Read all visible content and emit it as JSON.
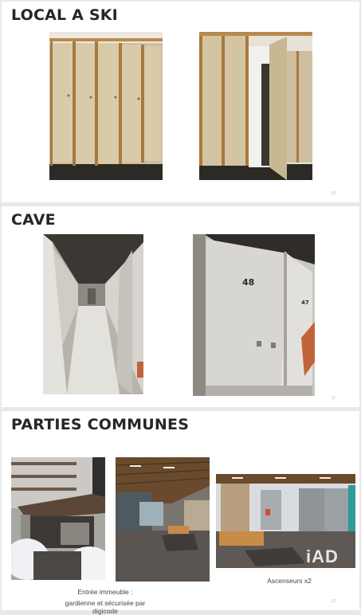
{
  "slides": [
    {
      "title": "LOCAL A SKI",
      "page": "10"
    },
    {
      "title": "CAVE",
      "page": "11"
    },
    {
      "title": "PARTIES COMMUNES",
      "page": "12"
    }
  ],
  "cave": {
    "door_number_left": "48",
    "door_number_right": "47"
  },
  "parties": {
    "caption_entrance_line1": "Entrée immeuble :",
    "caption_entrance_line2": "gardienne et sécurisée par digicode",
    "caption_elevators": "Ascenseurs x2",
    "watermark": "iAD"
  }
}
